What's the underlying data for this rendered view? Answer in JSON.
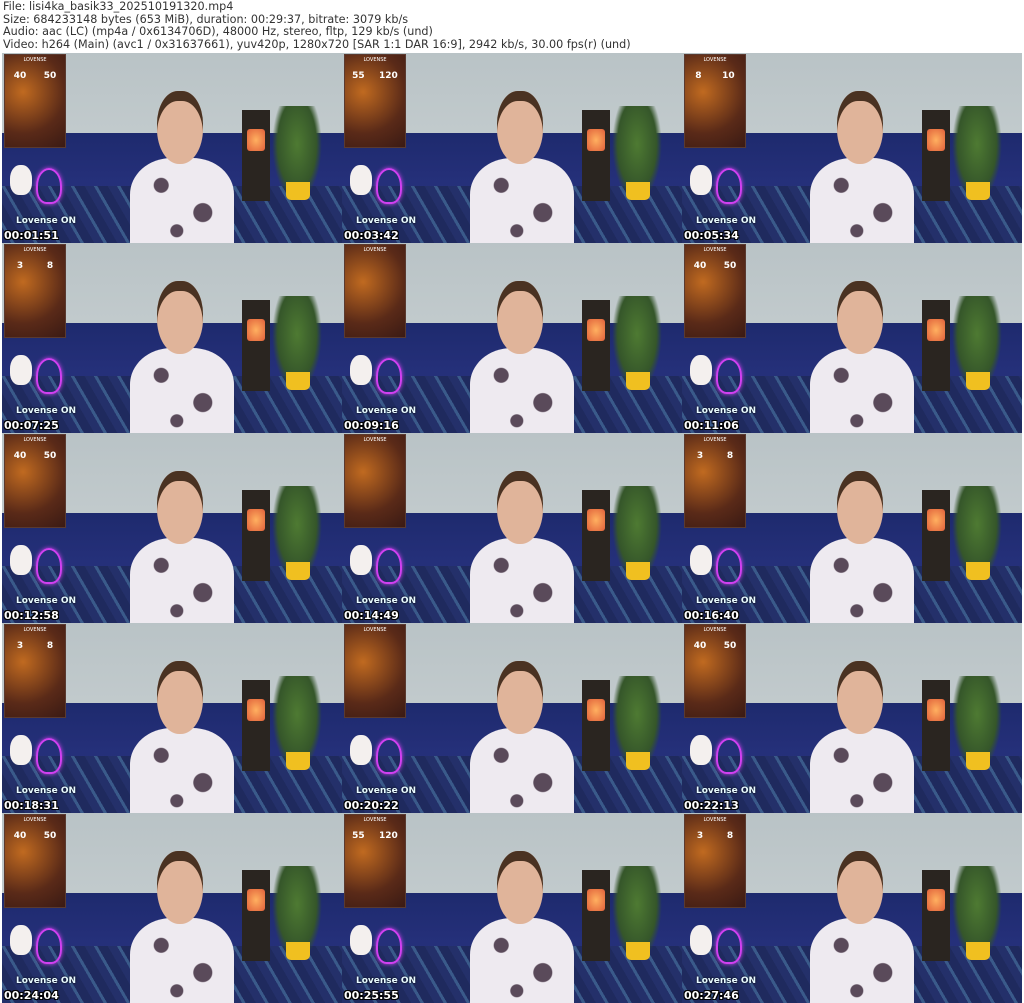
{
  "header": {
    "file": "File: lisi4ka_basik33_202510191320.mp4",
    "size": "Size: 684233148 bytes (653 MiB), duration: 00:29:37, bitrate: 3079 kb/s",
    "audio": "Audio: aac (LC) (mp4a / 0x6134706D), 48000 Hz, stereo, fltp, 129 kb/s (und)",
    "video": "Video: h264 (Main) (avc1 / 0x31637661), yuv420p, 1280x720 [SAR 1:1 DAR 16:9], 2942 kb/s, 30.00 fps(r) (und)"
  },
  "overlay": {
    "brand": "LOVENSE",
    "status": "Lovense ON"
  },
  "thumbnails": [
    {
      "time": "00:01:51",
      "a": "40",
      "b": "50"
    },
    {
      "time": "00:03:42",
      "a": "55",
      "b": "120"
    },
    {
      "time": "00:05:34",
      "a": "8",
      "b": "10"
    },
    {
      "time": "00:07:25",
      "a": "3",
      "b": "8"
    },
    {
      "time": "00:09:16",
      "a": "",
      "b": ""
    },
    {
      "time": "00:11:06",
      "a": "40",
      "b": "50"
    },
    {
      "time": "00:12:58",
      "a": "40",
      "b": "50"
    },
    {
      "time": "00:14:49",
      "a": "",
      "b": ""
    },
    {
      "time": "00:16:40",
      "a": "3",
      "b": "8"
    },
    {
      "time": "00:18:31",
      "a": "3",
      "b": "8"
    },
    {
      "time": "00:20:22",
      "a": "",
      "b": ""
    },
    {
      "time": "00:22:13",
      "a": "40",
      "b": "50"
    },
    {
      "time": "00:24:04",
      "a": "40",
      "b": "50"
    },
    {
      "time": "00:25:55",
      "a": "55",
      "b": "120"
    },
    {
      "time": "00:27:46",
      "a": "3",
      "b": "8"
    }
  ]
}
